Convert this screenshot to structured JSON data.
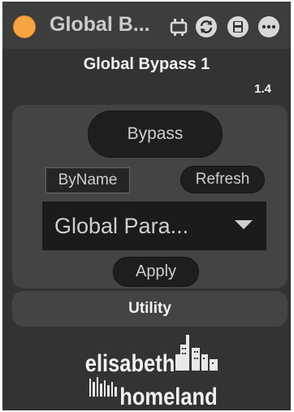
{
  "header": {
    "title": "Global B...",
    "icons": [
      "bridge-icon",
      "sync-icon",
      "save-icon",
      "more-icon"
    ]
  },
  "device": {
    "name": "Global Bypass 1",
    "version": "1.4"
  },
  "controls": {
    "bypass_label": "Bypass",
    "byname_label": "ByName",
    "refresh_label": "Refresh",
    "dropdown_value": "Global Para...",
    "apply_label": "Apply"
  },
  "utility_label": "Utility",
  "logo": {
    "line1": "elisabeth",
    "line2": "homeland"
  },
  "colors": {
    "power": "#f7a542",
    "background": "#333333",
    "panel": "#444444",
    "button": "#1e1e1e"
  }
}
